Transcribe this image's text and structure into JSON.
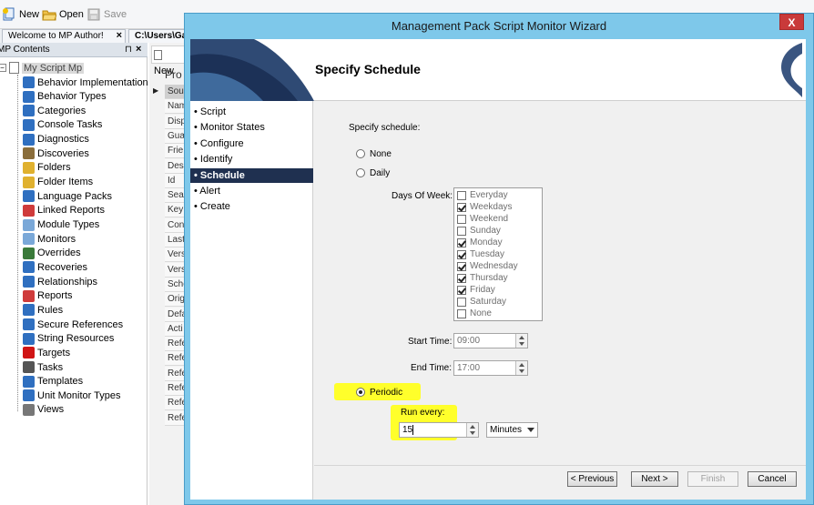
{
  "toolbar": {
    "new_label": "New",
    "open_label": "Open",
    "save_label": "Save"
  },
  "doc_tabs": [
    {
      "label": "Welcome to MP Author!"
    },
    {
      "label": "C:\\Users\\Ga"
    }
  ],
  "left_panel": {
    "title": "MP Contents",
    "root": "My Script Mp",
    "items": [
      {
        "label": "Behavior Implementation",
        "icon": "behavior-implementation-icon"
      },
      {
        "label": "Behavior Types",
        "icon": "behavior-types-icon"
      },
      {
        "label": "Categories",
        "icon": "categories-icon"
      },
      {
        "label": "Console Tasks",
        "icon": "console-tasks-icon"
      },
      {
        "label": "Diagnostics",
        "icon": "diagnostics-icon"
      },
      {
        "label": "Discoveries",
        "icon": "discoveries-icon"
      },
      {
        "label": "Folders",
        "icon": "folder-icon"
      },
      {
        "label": "Folder Items",
        "icon": "folder-items-icon"
      },
      {
        "label": "Language Packs",
        "icon": "language-packs-icon"
      },
      {
        "label": "Linked Reports",
        "icon": "linked-reports-icon"
      },
      {
        "label": "Module Types",
        "icon": "module-types-icon"
      },
      {
        "label": "Monitors",
        "icon": "monitors-icon"
      },
      {
        "label": "Overrides",
        "icon": "overrides-icon"
      },
      {
        "label": "Recoveries",
        "icon": "recoveries-icon"
      },
      {
        "label": "Relationships",
        "icon": "relationships-icon"
      },
      {
        "label": "Reports",
        "icon": "reports-icon"
      },
      {
        "label": "Rules",
        "icon": "rules-icon"
      },
      {
        "label": "Secure References",
        "icon": "secure-references-icon"
      },
      {
        "label": "String Resources",
        "icon": "string-resources-icon"
      },
      {
        "label": "Targets",
        "icon": "targets-icon"
      },
      {
        "label": "Tasks",
        "icon": "tasks-icon"
      },
      {
        "label": "Templates",
        "icon": "templates-icon"
      },
      {
        "label": "Unit Monitor Types",
        "icon": "unit-monitor-types-icon"
      },
      {
        "label": "Views",
        "icon": "views-icon"
      }
    ]
  },
  "middle_panel": {
    "doc_label": "New",
    "header": "Pro",
    "rows": [
      "Sou",
      "Nam",
      "Disp",
      "Gua",
      "Frie",
      "Des",
      "Id",
      "Sea",
      "Key",
      "Con",
      "Last",
      "Vers",
      "Vers",
      "Sche",
      "Orig",
      "Defa",
      "Acti",
      "Refe",
      "Refe",
      "Refe",
      "Refe",
      "Refe",
      "Refe"
    ]
  },
  "wizard": {
    "title": "Management Pack Script Monitor Wizard",
    "close_label": "X",
    "page_title": "Specify Schedule",
    "nav": [
      {
        "label": "• Script",
        "selected": false
      },
      {
        "label": "• Monitor States",
        "selected": false
      },
      {
        "label": "• Configure",
        "selected": false
      },
      {
        "label": "• Identify",
        "selected": false
      },
      {
        "label": "• Schedule",
        "selected": true
      },
      {
        "label": "• Alert",
        "selected": false
      },
      {
        "label": "• Create",
        "selected": false
      }
    ],
    "schedule": {
      "heading": "Specify schedule:",
      "option_none": "None",
      "option_daily": "Daily",
      "option_periodic": "Periodic",
      "selected_option": "Periodic",
      "days_of_week_label": "Days Of Week:",
      "days": [
        {
          "label": "Everyday",
          "checked": false
        },
        {
          "label": "Weekdays",
          "checked": true
        },
        {
          "label": "Weekend",
          "checked": false
        },
        {
          "label": "Sunday",
          "checked": false
        },
        {
          "label": "Monday",
          "checked": true
        },
        {
          "label": "Tuesday",
          "checked": true
        },
        {
          "label": "Wednesday",
          "checked": true
        },
        {
          "label": "Thursday",
          "checked": true
        },
        {
          "label": "Friday",
          "checked": true
        },
        {
          "label": "Saturday",
          "checked": false
        },
        {
          "label": "None",
          "checked": false
        }
      ],
      "start_time_label": "Start Time:",
      "start_time": "09:00",
      "end_time_label": "End Time:",
      "end_time": "17:00",
      "run_every_label": "Run every:",
      "run_every_value": "15",
      "unit": "Minutes"
    },
    "buttons": {
      "previous": "< Previous",
      "next": "Next >",
      "finish": "Finish",
      "cancel": "Cancel"
    }
  },
  "colors": {
    "wizard_frame": "#7ec8ea",
    "nav_selected": "#1f3050",
    "highlight": "#ffff2b"
  }
}
